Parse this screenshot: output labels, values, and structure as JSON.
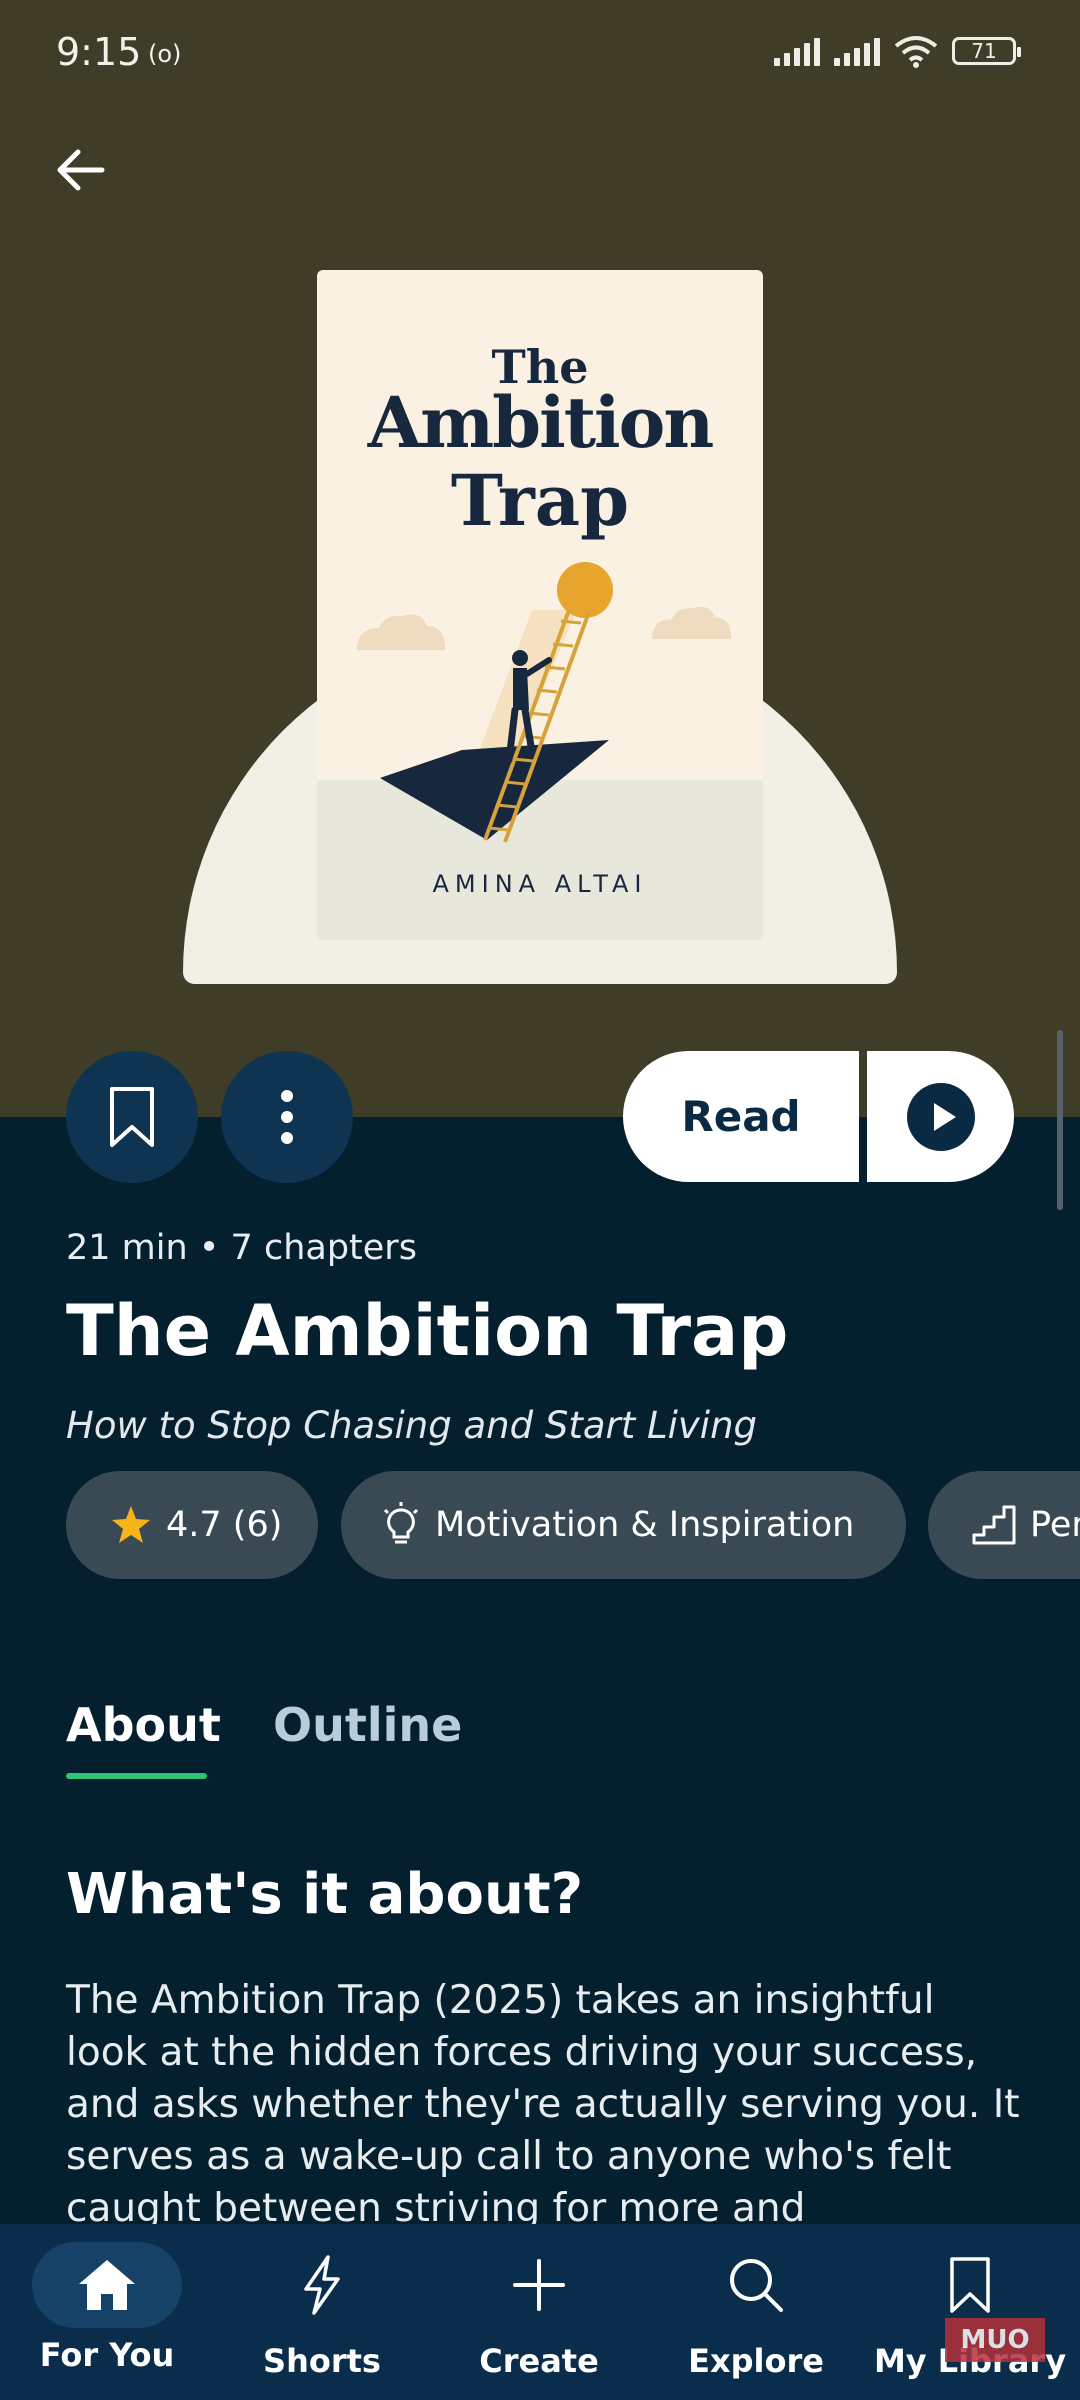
{
  "status_bar": {
    "time": "9:15",
    "indicator": "(o)",
    "battery": "71"
  },
  "book": {
    "cover_title_line1": "The",
    "cover_title_line2": "Ambition",
    "cover_title_line3": "Trap",
    "cover_author": "AMINA ALTAI",
    "meta": "21 min • 7 chapters",
    "title": "The Ambition Trap",
    "subtitle": "How to Stop Chasing and Start Living"
  },
  "actions": {
    "read_label": "Read"
  },
  "chips": [
    {
      "label": "4.7 (6)",
      "icon": "star-icon"
    },
    {
      "label": "Motivation & Inspiration",
      "icon": "lightbulb-icon"
    },
    {
      "label": "Per",
      "icon": "stairs-icon"
    }
  ],
  "tabs": [
    {
      "label": "About",
      "active": true
    },
    {
      "label": "Outline",
      "active": false
    }
  ],
  "about": {
    "heading": "What's it about?",
    "text": "The Ambition Trap (2025) takes an insightful look at the hidden forces driving your success, and asks whether they're actually serving you. It serves as a wake-up call to anyone who's felt caught between striving for more and"
  },
  "nav": [
    {
      "label": "For You",
      "icon": "home-icon",
      "active": true
    },
    {
      "label": "Shorts",
      "icon": "lightning-icon"
    },
    {
      "label": "Create",
      "icon": "plus-icon"
    },
    {
      "label": "Explore",
      "icon": "search-icon"
    },
    {
      "label": "My Library",
      "icon": "bookmark-icon"
    }
  ],
  "watermark": "MUO",
  "colors": {
    "header_bg": "#3f3c28",
    "page_bg": "#04202f",
    "accent_underline": "#2ec477",
    "chip_bg": "#3a4a55",
    "star": "#f5b41a"
  }
}
